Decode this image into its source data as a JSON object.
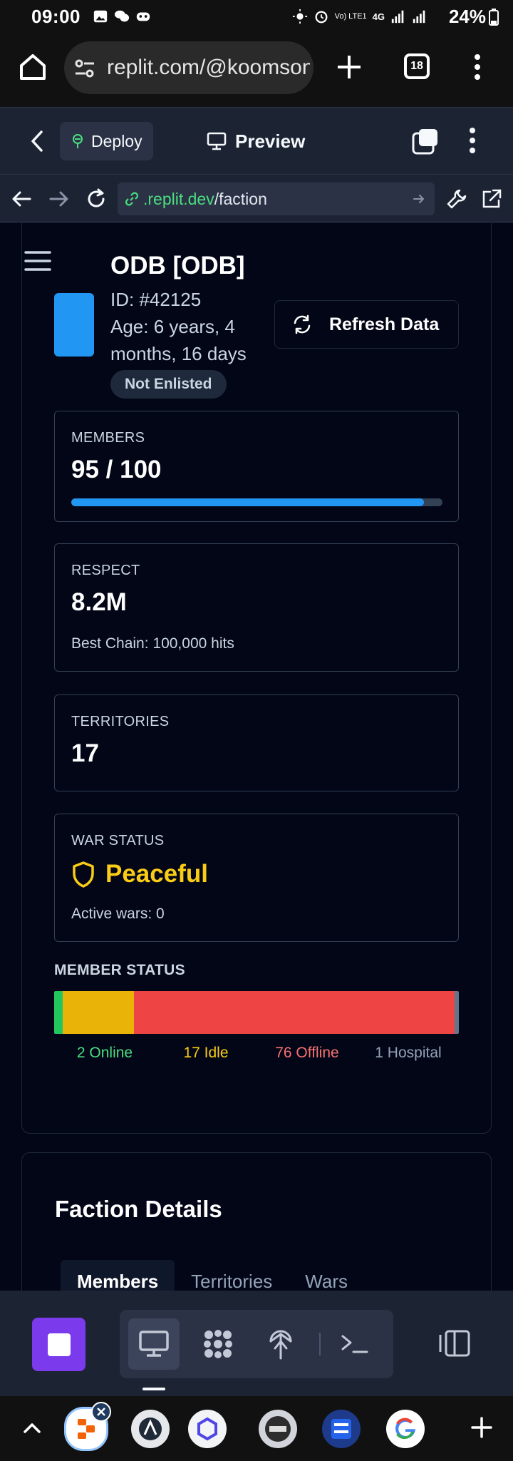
{
  "status_bar": {
    "time": "09:00",
    "battery": "24%",
    "network": "4G",
    "carrier_tag": "Vo) LTE1"
  },
  "browser": {
    "url": "replit.com/@koomsonk",
    "tab_count": "18"
  },
  "replit_header": {
    "deploy_label": "Deploy",
    "preview_label": "Preview"
  },
  "webview": {
    "address_host": ".replit.dev",
    "address_path": "/faction"
  },
  "faction": {
    "name": "ODB [ODB]",
    "id": "ID: #42125",
    "age": "Age: 6 years, 4 months, 16 days",
    "enlist_status": "Not Enlisted",
    "refresh_label": "Refresh Data",
    "logo_color": "#2196F3"
  },
  "stats": {
    "members": {
      "label": "MEMBERS",
      "value": "95 / 100",
      "progress": 0.95
    },
    "respect": {
      "label": "RESPECT",
      "value": "8.2M",
      "sub": "Best Chain: 100,000 hits"
    },
    "territories": {
      "label": "TERRITORIES",
      "value": "17"
    },
    "war": {
      "label": "WAR STATUS",
      "value": "Peaceful",
      "sub": "Active wars: 0",
      "icon": "shield-icon",
      "color": "#FACC15"
    }
  },
  "member_status": {
    "label": "MEMBER STATUS",
    "segments": [
      {
        "name": "online",
        "count": 2,
        "label": "2 Online",
        "color": "#22C55E"
      },
      {
        "name": "idle",
        "count": 17,
        "label": "17 Idle",
        "color": "#EAB308"
      },
      {
        "name": "offline",
        "count": 76,
        "label": "76 Offline",
        "color": "#EF4444"
      },
      {
        "name": "hospital",
        "count": 1,
        "label": "1 Hospital",
        "color": "#64748B"
      }
    ]
  },
  "details": {
    "title": "Faction Details",
    "tabs": [
      "Members",
      "Territories",
      "Wars"
    ],
    "active_tab": "Members"
  },
  "colors": {
    "accent": "#2196F3",
    "replit_purple": "#7C3AED",
    "online": "#22C55E",
    "idle": "#EAB308",
    "offline": "#EF4444",
    "hospital": "#64748B"
  }
}
